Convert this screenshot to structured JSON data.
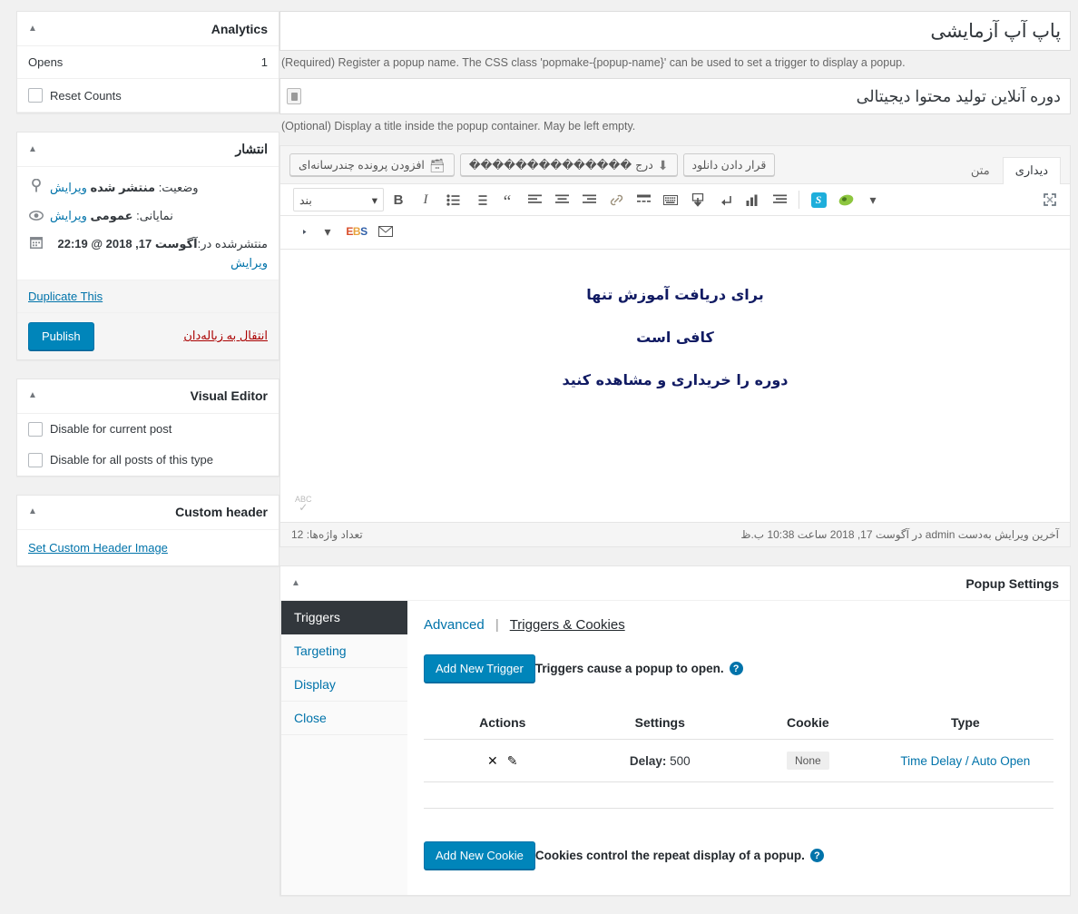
{
  "sidebar": {
    "analytics": {
      "title": "Analytics",
      "toggle_icon": "chevron-up-icon",
      "rows": [
        {
          "label": "Opens",
          "value": "1"
        }
      ],
      "reset_label": "Reset Counts",
      "reset_checked": false
    },
    "publish": {
      "title": "انتشار",
      "toggle_icon": "chevron-up-icon",
      "status_icon": "pin-icon",
      "status_prefix": "وضعیت:",
      "status_value": "منتشر شده",
      "status_edit": "ویرایش",
      "visibility_icon": "eye-icon",
      "visibility_prefix": "نمایانی:",
      "visibility_value": "عمومی",
      "visibility_edit": "ویرایش",
      "date_icon": "calendar-icon",
      "date_prefix": "منتشرشده در:",
      "date_value": "آگوست 17, 2018 @ 22:19",
      "date_edit": "ویرایش",
      "duplicate_label": "Duplicate This",
      "trash_label": "انتقال به زباله‌دان",
      "publish_label": "Publish"
    },
    "visual_editor": {
      "title": "Visual Editor",
      "toggle_icon": "chevron-up-icon",
      "rows": [
        {
          "label": "Disable for current post",
          "checked": false
        },
        {
          "label": "Disable for all posts of this type",
          "checked": false
        }
      ]
    },
    "custom_header": {
      "title": "Custom header",
      "toggle_icon": "chevron-up-icon",
      "link_label": "Set Custom Header Image"
    }
  },
  "main": {
    "popup_name": {
      "value": "پاپ آپ آزمایشی",
      "placeholder": "",
      "help": "(Required) Register a popup name. The CSS class 'popmake-{popup-name}' can be used to set a trigger to display a popup."
    },
    "popup_title": {
      "value": "دوره آنلاین تولید محتوا دیجیتالی",
      "placeholder": "",
      "help": "(Optional) Display a title inside the popup container. May be left empty.",
      "field_icon": "form-field-icon"
    },
    "editor": {
      "media_buttons": [
        {
          "label": "افزودن پرونده چندرسانه‌ای",
          "icon": "add-media-icon"
        },
        {
          "label": "درج ��������������",
          "icon": "insert-download-icon"
        },
        {
          "label": "قرار دادن دانلود",
          "icon": ""
        }
      ],
      "tabs": [
        {
          "label": "دیداری",
          "active": true
        },
        {
          "label": "متن",
          "active": false
        }
      ],
      "format_select": {
        "value": "بند",
        "caret": "chevron-down-icon"
      },
      "toolbar_row1": [
        {
          "name": "bold-icon",
          "glyph": "B"
        },
        {
          "name": "italic-icon",
          "glyph": "I"
        },
        {
          "name": "bulleted-list-icon",
          "glyph": "☰"
        },
        {
          "name": "numbered-list-icon",
          "glyph": "≡"
        },
        {
          "name": "blockquote-icon",
          "glyph": "“"
        },
        {
          "name": "align-right-icon",
          "glyph": "≡"
        },
        {
          "name": "align-center-icon",
          "glyph": "≡"
        },
        {
          "name": "align-left-icon",
          "glyph": "≡"
        },
        {
          "name": "insert-link-icon",
          "glyph": "🔗"
        },
        {
          "name": "read-more-icon",
          "glyph": "▤"
        },
        {
          "name": "keyboard-shortcuts-icon",
          "glyph": "⌨"
        },
        {
          "name": "insert-download-arrow-icon",
          "glyph": "⬇"
        },
        {
          "name": "undo-icon",
          "glyph": "↩"
        },
        {
          "name": "chart-icon",
          "glyph": "📊"
        },
        {
          "name": "align-text-icon",
          "glyph": "≡"
        },
        {
          "name": "shortcode-s-icon",
          "glyph": "S"
        },
        {
          "name": "olive-media-icon",
          "glyph": "◉"
        },
        {
          "name": "chevron-down-icon",
          "glyph": "▾"
        },
        {
          "name": "fullscreen-icon",
          "glyph": "⤢"
        }
      ],
      "toolbar_row2": [
        {
          "name": "rtl-paragraph-icon",
          "glyph": "¶"
        },
        {
          "name": "chevron-down-icon",
          "glyph": "▾"
        },
        {
          "name": "ebs-icon",
          "glyph": "EBS"
        },
        {
          "name": "email-icon",
          "glyph": "✉"
        }
      ],
      "content_paragraphs": [
        "برای دریافت آموزش تنها",
        "کافی است",
        "دوره را خریداری و مشاهده کنید"
      ],
      "spellcheck_badge": "ABC",
      "statusbar": {
        "word_count": "تعداد واژه‌ها: 12",
        "last_edited": "آخرین ویرایش به‌دست admin در آگوست 17, 2018 ساعت 10:38 ب.ظ"
      }
    },
    "popup_settings": {
      "title": "Popup Settings",
      "toggle_icon": "chevron-up-icon",
      "tabs": [
        {
          "label": "Triggers",
          "active": true
        },
        {
          "label": "Targeting",
          "active": false
        },
        {
          "label": "Display",
          "active": false
        },
        {
          "label": "Close",
          "active": false
        }
      ],
      "subtabs": {
        "active_label": "Triggers & Cookies",
        "separator": "|",
        "other_label": "Advanced"
      },
      "triggers": {
        "description": "Triggers cause a popup to open.",
        "help_icon": "question-mark-icon",
        "add_button": "Add New Trigger",
        "columns": [
          "Type",
          "Cookie",
          "Settings",
          "Actions"
        ],
        "rows": [
          {
            "type": "Time Delay / Auto Open",
            "cookie": "None",
            "settings_label": "Delay:",
            "settings_value": "500",
            "actions": [
              {
                "name": "delete-trigger-icon",
                "glyph": "✕"
              },
              {
                "name": "edit-trigger-icon",
                "glyph": "✎"
              }
            ]
          }
        ]
      },
      "cookies": {
        "description": "Cookies control the repeat display of a popup.",
        "help_icon": "question-mark-icon",
        "add_button": "Add New Cookie"
      }
    }
  },
  "colors": {
    "wp_blue": "#0085ba",
    "link_blue": "#0073aa",
    "dark_tab": "#32373c",
    "trash_red": "#a00",
    "editor_text": "#111b63"
  }
}
